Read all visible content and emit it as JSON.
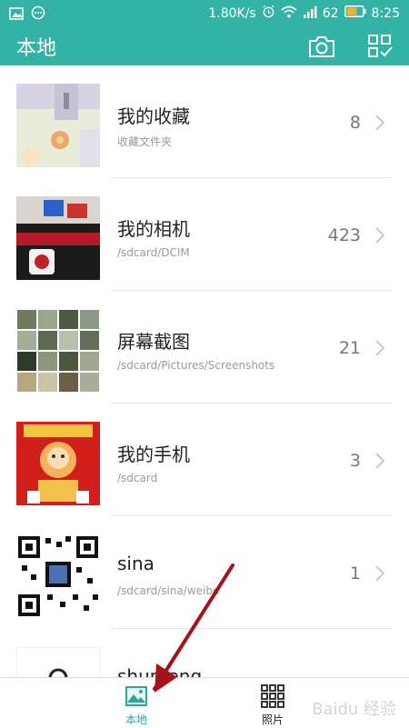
{
  "status_bar": {
    "network_speed": "1.80K/s",
    "battery": "62",
    "time": "8:25"
  },
  "app_bar": {
    "title": "本地"
  },
  "albums": [
    {
      "name": "我的收藏",
      "path": "收藏文件夹",
      "count": "8"
    },
    {
      "name": "我的相机",
      "path": "/sdcard/DCIM",
      "count": "423"
    },
    {
      "name": "屏幕截图",
      "path": "/sdcard/Pictures/Screenshots",
      "count": "21"
    },
    {
      "name": "我的手机",
      "path": "/sdcard",
      "count": "3"
    },
    {
      "name": "sina",
      "path": "/sdcard/sina/weibo",
      "count": "1"
    },
    {
      "name": "shunfeng",
      "path": "",
      "count": ""
    }
  ],
  "bottom_nav": {
    "local_label": "本地",
    "photos_label": "照片"
  },
  "watermark": "Baidu 经验",
  "colors": {
    "accent": "#33b3a6",
    "annotation_arrow": "#a5121a"
  },
  "annotation": {
    "type": "arrow",
    "points_to": "bottom-nav-local-tab"
  }
}
